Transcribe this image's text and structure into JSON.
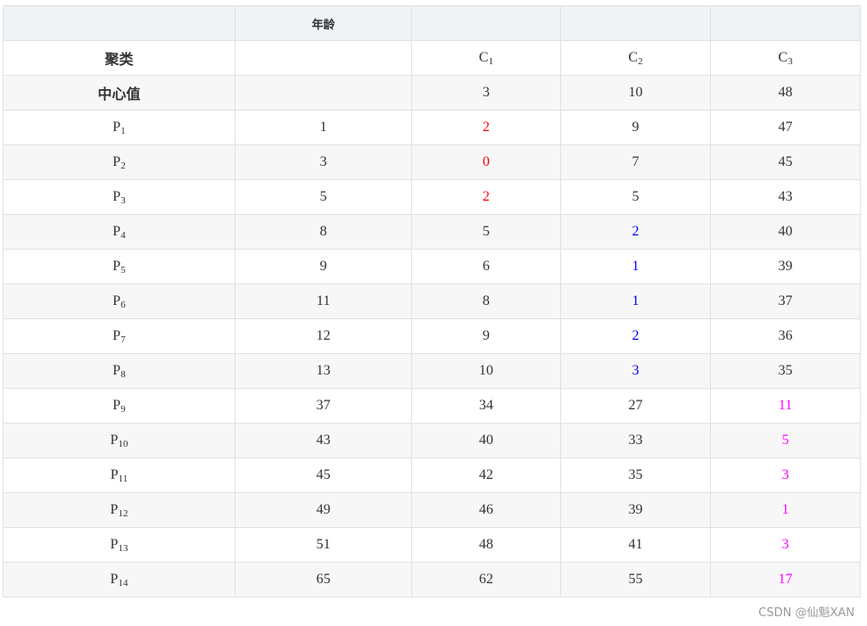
{
  "header": {
    "col1": "",
    "col2": "年龄",
    "col3": "",
    "col4": "",
    "col5": ""
  },
  "cluster_row": {
    "label": "聚类",
    "c1": "C",
    "c1_sub": "1",
    "c2": "C",
    "c2_sub": "2",
    "c3": "C",
    "c3_sub": "3"
  },
  "center_row": {
    "label": "中心值",
    "c1": "3",
    "c2": "10",
    "c3": "48"
  },
  "rows": [
    {
      "p": "P",
      "sub": "1",
      "age": "1",
      "d1": "2",
      "d2": "9",
      "d3": "47"
    },
    {
      "p": "P",
      "sub": "2",
      "age": "3",
      "d1": "0",
      "d2": "7",
      "d3": "45"
    },
    {
      "p": "P",
      "sub": "3",
      "age": "5",
      "d1": "2",
      "d2": "5",
      "d3": "43"
    },
    {
      "p": "P",
      "sub": "4",
      "age": "8",
      "d1": "5",
      "d2": "2",
      "d3": "40"
    },
    {
      "p": "P",
      "sub": "5",
      "age": "9",
      "d1": "6",
      "d2": "1",
      "d3": "39"
    },
    {
      "p": "P",
      "sub": "6",
      "age": "11",
      "d1": "8",
      "d2": "1",
      "d3": "37"
    },
    {
      "p": "P",
      "sub": "7",
      "age": "12",
      "d1": "9",
      "d2": "2",
      "d3": "36"
    },
    {
      "p": "P",
      "sub": "8",
      "age": "13",
      "d1": "10",
      "d2": "3",
      "d3": "35"
    },
    {
      "p": "P",
      "sub": "9",
      "age": "37",
      "d1": "34",
      "d2": "27",
      "d3": "11"
    },
    {
      "p": "P",
      "sub": "10",
      "age": "43",
      "d1": "40",
      "d2": "33",
      "d3": "5"
    },
    {
      "p": "P",
      "sub": "11",
      "age": "45",
      "d1": "42",
      "d2": "35",
      "d3": "3"
    },
    {
      "p": "P",
      "sub": "12",
      "age": "49",
      "d1": "46",
      "d2": "39",
      "d3": "1"
    },
    {
      "p": "P",
      "sub": "13",
      "age": "51",
      "d1": "48",
      "d2": "41",
      "d3": "3"
    },
    {
      "p": "P",
      "sub": "14",
      "age": "65",
      "d1": "62",
      "d2": "55",
      "d3": "17"
    }
  ],
  "highlight_colors": {
    "cluster1": "#ff0000",
    "cluster2": "#0000ff",
    "cluster3": "#ff00ff"
  },
  "watermark": "CSDN @仙魁XAN"
}
